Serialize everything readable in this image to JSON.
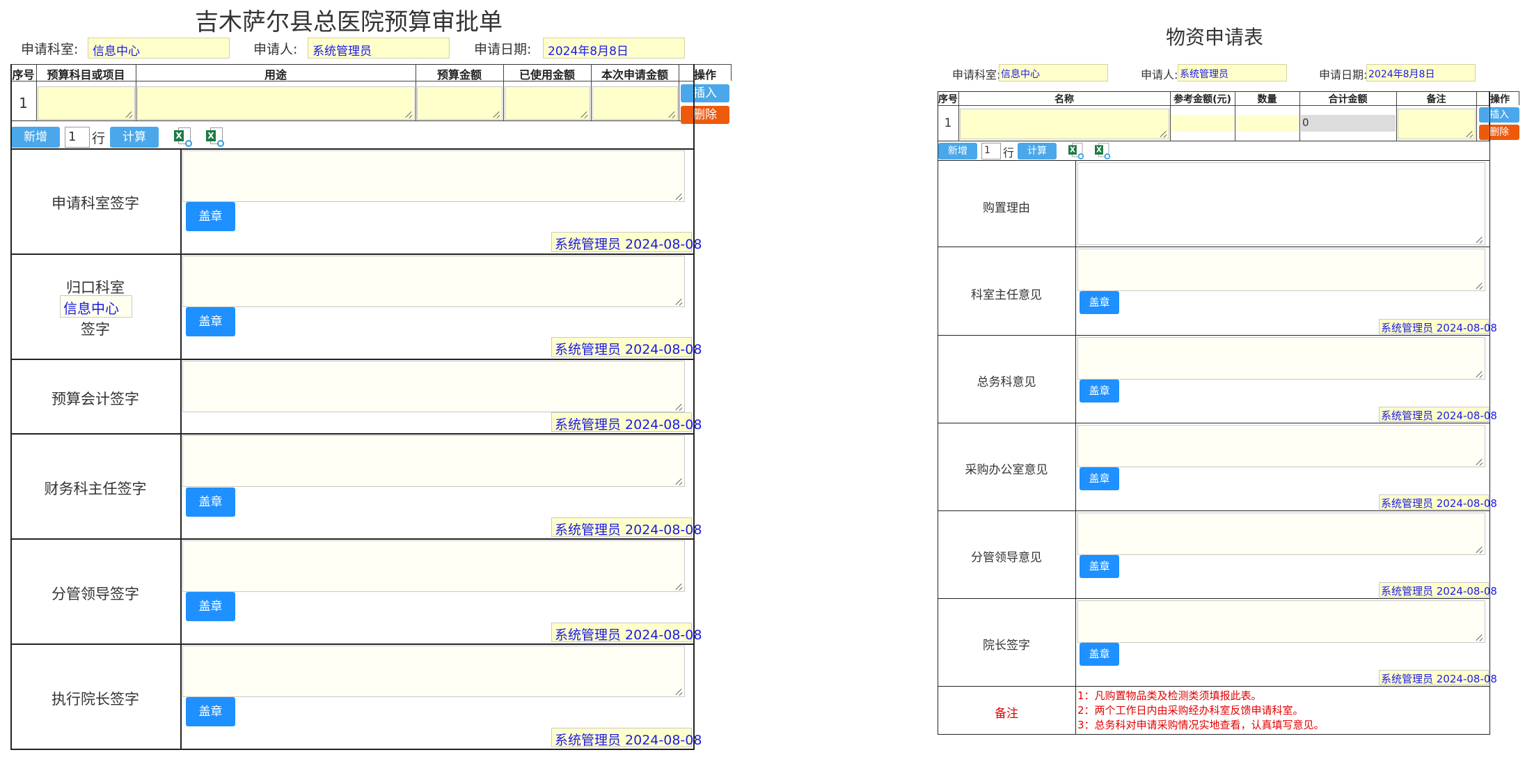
{
  "budget": {
    "title": "吉木萨尔县总医院预算审批单",
    "dept_label": "申请科室:",
    "dept_value": "信息中心",
    "applicant_label": "申请人:",
    "applicant_value": "系统管理员",
    "date_label": "申请日期:",
    "date_value": "2024年8月8日",
    "headers": [
      "序号",
      "预算科目或项目",
      "用途",
      "预算金额",
      "已使用金额",
      "本次申请金额",
      "操作"
    ],
    "row_no": "1",
    "insert_label": "插入",
    "delete_label": "删除",
    "add_label": "新增",
    "rows_count": "1",
    "rows_unit": "行",
    "calc_label": "计算",
    "stamp_label": "盖章",
    "sections": [
      {
        "label": "申请科室签字",
        "signature": "系统管理员 2024-08-08"
      },
      {
        "label_top": "归口科室",
        "dept_value": "信息中心",
        "label_bottom": "签字",
        "signature": "系统管理员 2024-08-08"
      },
      {
        "label": "预算会计签字",
        "signature": "系统管理员 2024-08-08"
      },
      {
        "label": "财务科主任签字",
        "signature": "系统管理员 2024-08-08"
      },
      {
        "label": "分管领导签字",
        "signature": "系统管理员 2024-08-08"
      },
      {
        "label": "执行院长签字",
        "signature": "系统管理员 2024-08-08"
      }
    ]
  },
  "supply": {
    "title": "物资申请表",
    "dept_label": "申请科室:",
    "dept_value": "信息中心",
    "applicant_label": "申请人:",
    "applicant_value": "系统管理员",
    "date_label": "申请日期:",
    "date_value": "2024年8月8日",
    "headers": [
      "序号",
      "名称",
      "参考金额(元)",
      "数量",
      "合计金额",
      "备注",
      "操作"
    ],
    "row_no": "1",
    "total_value": "0",
    "insert_label": "插入",
    "delete_label": "删除",
    "add_label": "新增",
    "rows_count": "1",
    "rows_unit": "行",
    "calc_label": "计算",
    "stamp_label": "盖章",
    "reason_label": "购置理由",
    "sections": [
      {
        "label": "科室主任意见",
        "signature": "系统管理员 2024-08-08"
      },
      {
        "label": "总务科意见",
        "signature": "系统管理员 2024-08-08"
      },
      {
        "label": "采购办公室意见",
        "signature": "系统管理员 2024-08-08"
      },
      {
        "label": "分管领导意见",
        "signature": "系统管理员 2024-08-08"
      },
      {
        "label": "院长签字",
        "signature": "系统管理员 2024-08-08"
      }
    ],
    "remarks_label": "备注",
    "remarks": [
      "1：凡购置物品类及检测类须填报此表。",
      "2：两个工作日内由采购经办科室反馈申请科室。",
      "3：总务科对申请采购情况实地查看，认真填写意见。"
    ]
  },
  "icons": {
    "excel_import": "excel-import-icon",
    "excel_export": "excel-export-icon",
    "resize": "resize-grip-icon"
  },
  "colors": {
    "field_bg": "#ffffcc",
    "button_blue": "#1e90ff",
    "button_orange": "#ee5a0c",
    "value_blue": "#1a1ae6",
    "remark_red": "#e10000"
  }
}
